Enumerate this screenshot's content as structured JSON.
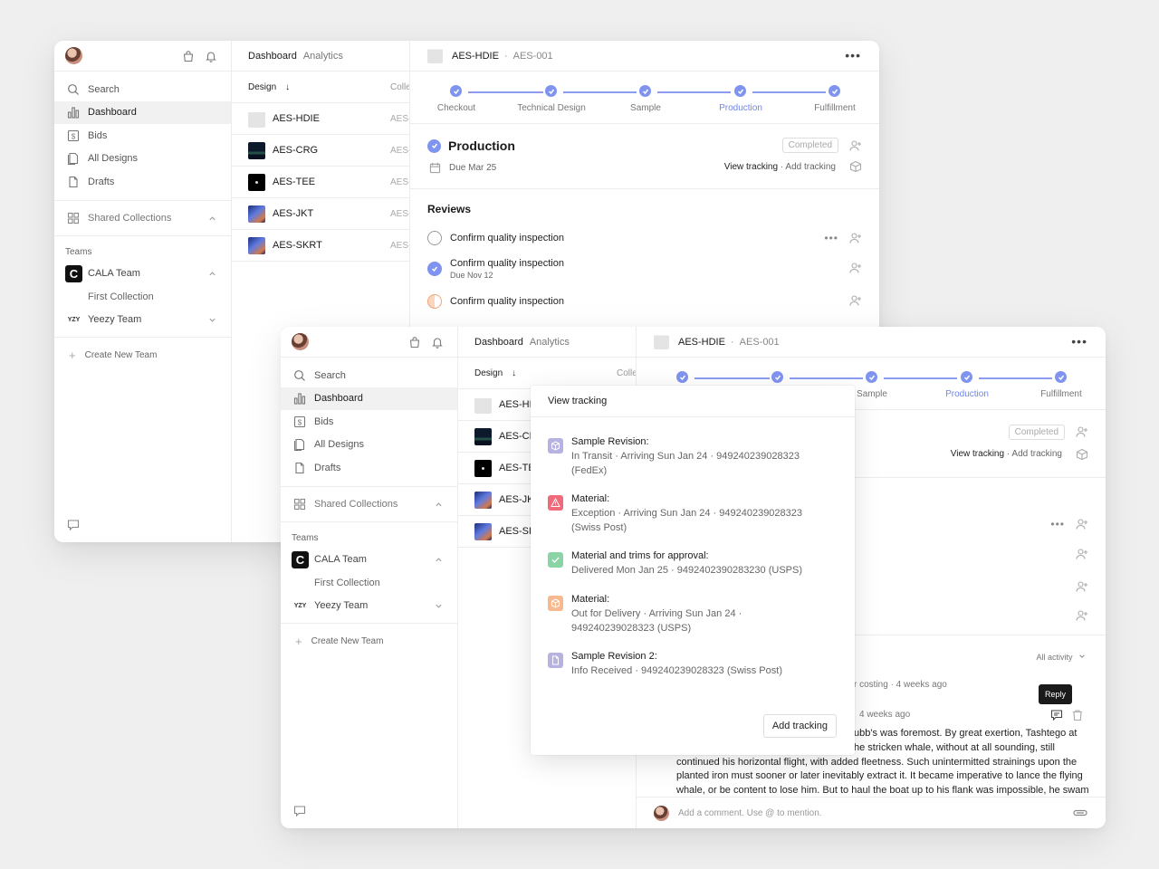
{
  "sidebar": {
    "search": "Search",
    "items": [
      {
        "label": "Dashboard",
        "icon": "bar-chart-icon"
      },
      {
        "label": "Bids",
        "icon": "dollar-icon"
      },
      {
        "label": "All Designs",
        "icon": "designs-icon"
      },
      {
        "label": "Drafts",
        "icon": "file-icon"
      }
    ],
    "shared_collections": "Shared Collections",
    "teams_label": "Teams",
    "team_cala": "CALA Team",
    "team_cala_logo": "C",
    "first_collection": "First Collection",
    "team_yeezy": "Yeezy Team",
    "team_yeezy_logo": "YZY",
    "create_team": "Create New Team",
    "create_plus": "+"
  },
  "design_list": {
    "tab_dashboard": "Dashboard",
    "tab_analytics": "Analytics",
    "col_design": "Design",
    "sort_arrow": "↓",
    "col_collection": "Colle",
    "rows": [
      {
        "name": "AES-HDIE",
        "col": "AES-"
      },
      {
        "name": "AES-CRG",
        "col": "AES-"
      },
      {
        "name": "AES-TEE",
        "col": "AES-"
      },
      {
        "name": "AES-JKT",
        "col": "AES-"
      },
      {
        "name": "AES-SKRT",
        "col": "AES-"
      }
    ],
    "rows_back": [
      {
        "name": "AES-HD"
      },
      {
        "name": "AES-CR"
      },
      {
        "name": "AES-TE"
      },
      {
        "name": "AES-JK"
      },
      {
        "name": "AES-SK"
      }
    ]
  },
  "detail": {
    "design": "AES-HDIE",
    "sep": "·",
    "code": "AES-001",
    "more": "•••",
    "steps": [
      "Checkout",
      "Technical Design",
      "Sample",
      "Production",
      "Fulfillment"
    ],
    "active_step": "Production",
    "production_title": "Production",
    "due": "Due Mar 25",
    "status_badge": "Completed",
    "view_tracking": "View tracking",
    "add_tracking_link": "Add tracking",
    "reviews_title": "Reviews",
    "reviews": [
      {
        "label": "Confirm quality inspection",
        "sub": ""
      },
      {
        "label": "Confirm quality inspection",
        "sub": "Due Nov 12"
      },
      {
        "label": "Confirm quality inspection",
        "sub": ""
      }
    ],
    "all_activity": "All activity",
    "activity_meta_1": "r costing · 4 weeks ago",
    "activity_meta_2": "4 weeks ago",
    "comment_line1": "ubb's was foremost. By great exertion, Tashtego at",
    "comment_line2": "he stricken whale, without at all sounding, still",
    "comment_line3": "continued his horizontal flight, with added fleetness. Such unintermitted strainings upon the",
    "comment_line4": "planted iron must sooner or later inevitably extract it. It became imperative to lance the flying",
    "comment_line5": "whale, or be content to lose him. But to haul the boat up to his flank was impossible, he swam",
    "comment_placeholder": "Add a comment. Use @ to mention.",
    "reply_tooltip": "Reply"
  },
  "tracking_popover": {
    "title": "View tracking",
    "add_button": "Add tracking",
    "entries": [
      {
        "title": "Sample Revision:",
        "detail": "In Transit · Arriving Sun Jan 24 · 949240239028323 (FedEx)",
        "icon": "package-icon",
        "color": "#b6b3e3"
      },
      {
        "title": "Material:",
        "detail": "Exception · Arriving Sun Jan 24 · 949240239028323 (Swiss Post)",
        "icon": "warning-icon",
        "color": "#f06a7a"
      },
      {
        "title": "Material and trims for approval:",
        "detail": "Delivered Mon Jan 25 · 9492402390283230 (USPS)",
        "icon": "check-icon",
        "color": "#8ad4a5"
      },
      {
        "title": "Material:",
        "detail": "Out for Delivery · Arriving Sun Jan 24 · 949240239028323 (USPS)",
        "icon": "box-icon",
        "color": "#f7b98f"
      },
      {
        "title": "Sample Revision 2:",
        "detail": "Info Received · 949240239028323 (Swiss Post)",
        "icon": "document-icon",
        "color": "#b6b3e3"
      }
    ]
  },
  "colors": {
    "accent": "#7f93f0",
    "accent_text": "#6f86ee"
  }
}
